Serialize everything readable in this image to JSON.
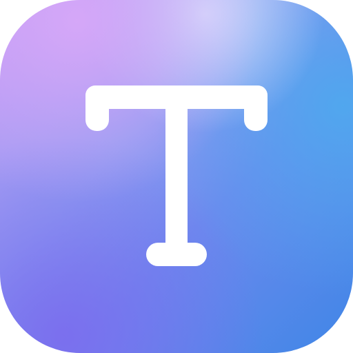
{
  "app_icon": {
    "name": "text-tool",
    "glyph_icon": "letter-t-icon",
    "glyph_color": "#ffffff",
    "background_colors": {
      "top_left": "#d7a8f8",
      "top_center": "#d6e0fc",
      "right": "#4eaaee",
      "bottom_left": "#7c6cee",
      "bottom_right": "#2f7fe4"
    }
  }
}
